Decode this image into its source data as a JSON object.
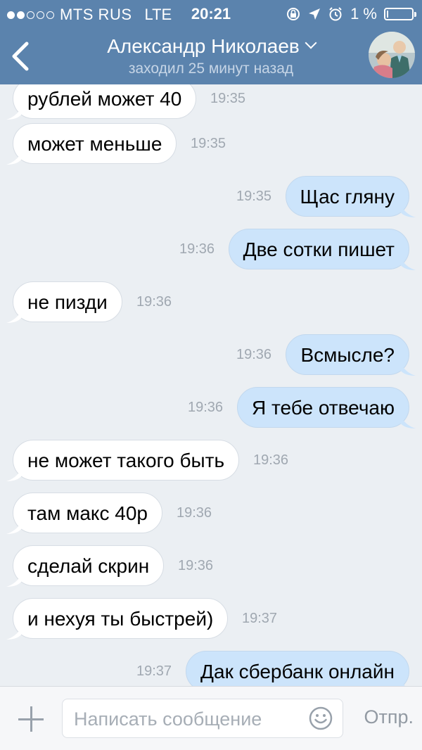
{
  "status_bar": {
    "carrier": "MTS RUS",
    "network": "LTE",
    "time": "20:21",
    "battery": "1 %"
  },
  "header": {
    "contact_name": "Александр Николаев",
    "last_seen": "заходил 25 минут назад"
  },
  "messages": [
    {
      "dir": "in",
      "text": "рублей может 40",
      "time": "19:35"
    },
    {
      "dir": "in",
      "text": "может меньше",
      "time": "19:35"
    },
    {
      "dir": "out",
      "text": "Щас гляну",
      "time": "19:35"
    },
    {
      "dir": "out",
      "text": "Две сотки пишет",
      "time": "19:36"
    },
    {
      "dir": "in",
      "text": "не пизди",
      "time": "19:36"
    },
    {
      "dir": "out",
      "text": "Всмысле?",
      "time": "19:36"
    },
    {
      "dir": "out",
      "text": "Я тебе отвечаю",
      "time": "19:36"
    },
    {
      "dir": "in",
      "text": "не может такого быть",
      "time": "19:36"
    },
    {
      "dir": "in",
      "text": "там макс 40р",
      "time": "19:36"
    },
    {
      "dir": "in",
      "text": "сделай скрин",
      "time": "19:36"
    },
    {
      "dir": "in",
      "text": "и нехуя ты быстрей)",
      "time": "19:37"
    },
    {
      "dir": "out",
      "text": "Дак сбербанк онлайн",
      "time": "19:37"
    }
  ],
  "composer": {
    "placeholder": "Написать сообщение",
    "send_label": "Отпр."
  },
  "colors": {
    "header": "#5b83ad",
    "background": "#ebeff3",
    "incoming_bubble": "#ffffff",
    "outgoing_bubble": "#cce4fb"
  }
}
